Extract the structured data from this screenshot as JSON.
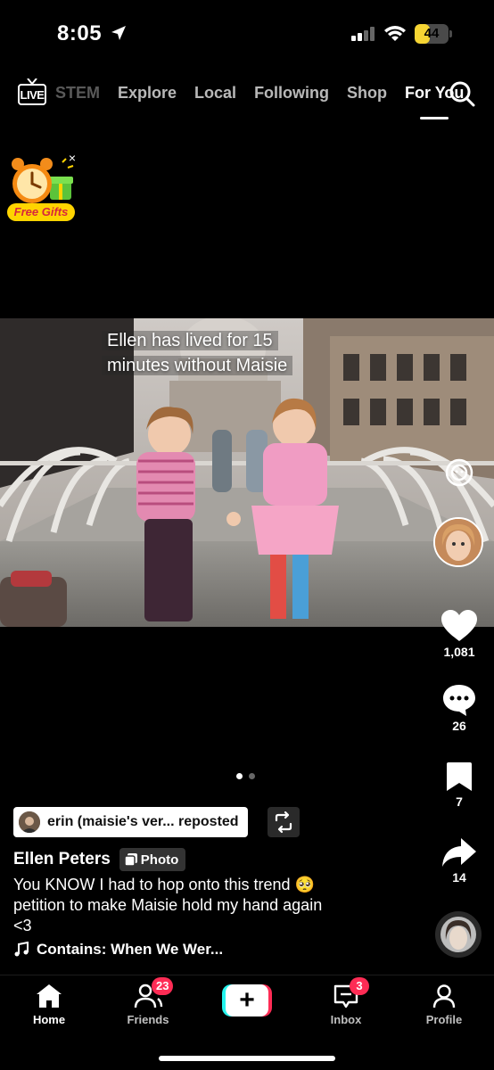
{
  "status_bar": {
    "time": "8:05",
    "battery_level": "44",
    "battery_fraction": 0.44,
    "colors": {
      "battery_fill": "#f6d533"
    }
  },
  "top_nav": {
    "live_label": "LIVE",
    "tabs": [
      {
        "label": "STEM",
        "state": "faded"
      },
      {
        "label": "Explore",
        "state": "normal"
      },
      {
        "label": "Local",
        "state": "normal"
      },
      {
        "label": "Following",
        "state": "normal"
      },
      {
        "label": "Shop",
        "state": "normal"
      },
      {
        "label": "For You",
        "state": "active"
      }
    ],
    "search_icon": "search-icon"
  },
  "gift": {
    "label": "Free Gifts",
    "close": "×",
    "icon": "alarm-clock-gift-icon"
  },
  "post": {
    "overlay_text_line1": "Ellen has lived for 15",
    "overlay_text_line2": "minutes without Maisie",
    "repost_text": "erin (maisie's ver... reposted",
    "author": "Ellen Peters",
    "type_badge": "Photo",
    "caption_line1": "You KNOW I had to hop onto this trend 🥺",
    "caption_line2": "petition to make Maisie hold my hand again",
    "caption_line3": "<3",
    "music": "Contains: When We Wer...",
    "carousel_index": 1,
    "carousel_total": 2
  },
  "actions": {
    "likes": "1,081",
    "comments": "26",
    "saves": "7",
    "shares": "14"
  },
  "bottom_nav": {
    "home": "Home",
    "friends": "Friends",
    "friends_badge": "23",
    "inbox": "Inbox",
    "inbox_badge": "3",
    "profile": "Profile",
    "create": "+",
    "colors": {
      "badge": "#fe2c55",
      "create_cyan": "#25f4ee",
      "create_red": "#fe2c55"
    }
  }
}
